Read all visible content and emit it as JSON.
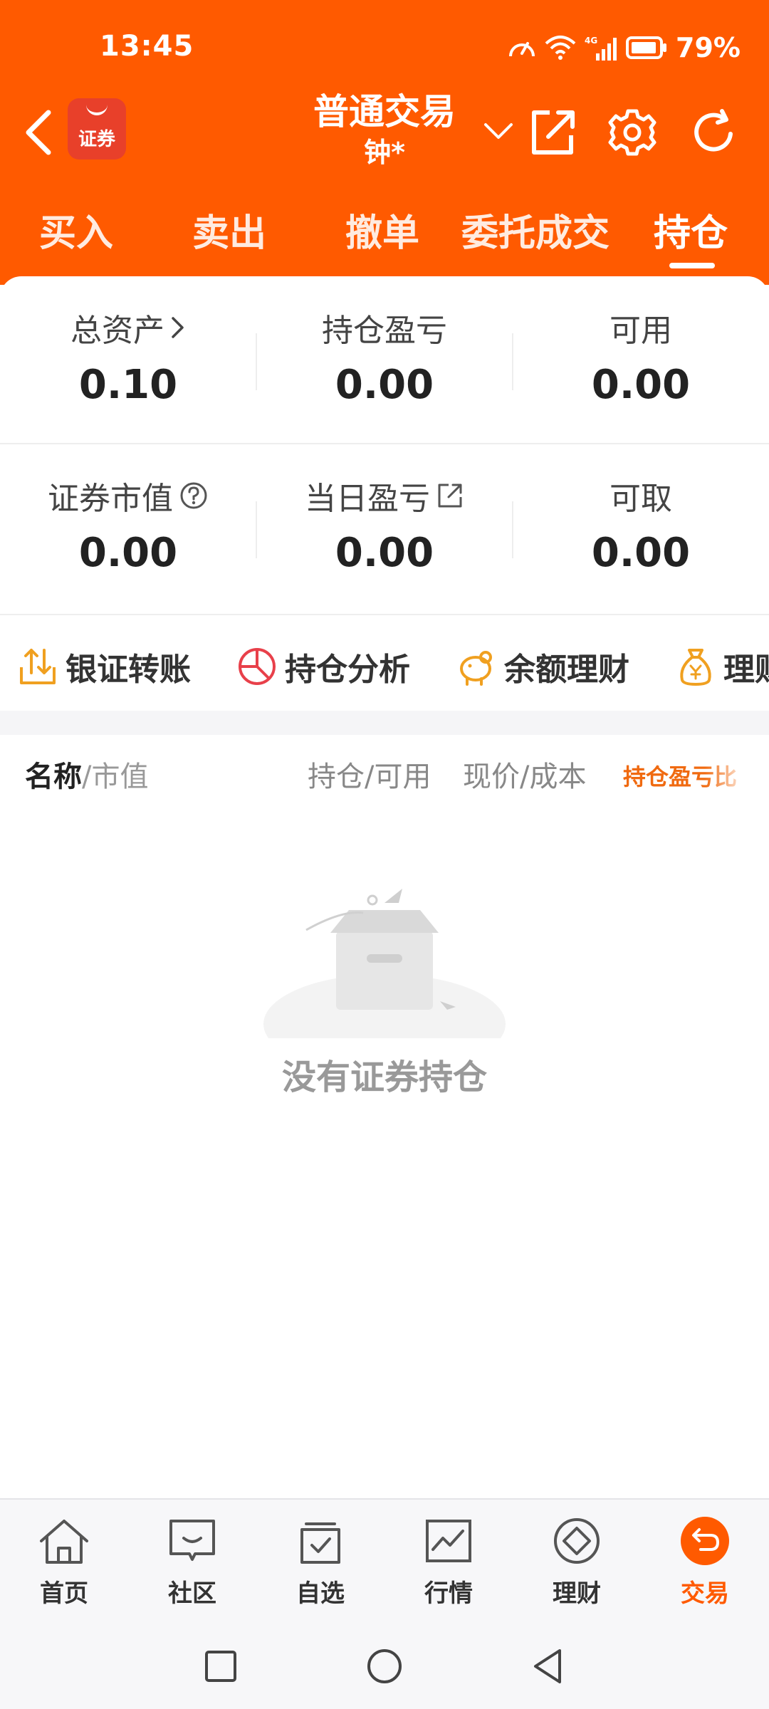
{
  "status_bar": {
    "time": "13:45",
    "battery": "79%",
    "network": "4G"
  },
  "header": {
    "title": "普通交易",
    "account": "钟*",
    "logo_text": "证券",
    "brand_color": "#ff5a00",
    "icons": [
      "back-icon",
      "share-icon",
      "gear-icon",
      "refresh-icon"
    ]
  },
  "tabs": [
    {
      "label": "买入",
      "active": false
    },
    {
      "label": "卖出",
      "active": false
    },
    {
      "label": "撤单",
      "active": false
    },
    {
      "label": "委托成交",
      "active": false
    },
    {
      "label": "持仓",
      "active": true
    }
  ],
  "summary": {
    "row1": [
      {
        "label": "总资产",
        "value": "0.10"
      },
      {
        "label": "持仓盈亏",
        "value": "0.00"
      },
      {
        "label": "可用",
        "value": "0.00"
      }
    ],
    "row2": [
      {
        "label": "证券市值",
        "value": "0.00"
      },
      {
        "label": "当日盈亏",
        "value": "0.00"
      },
      {
        "label": "可取",
        "value": "0.00"
      }
    ]
  },
  "quick_actions": [
    {
      "label": "银证转账",
      "icon": "transfer-icon"
    },
    {
      "label": "持仓分析",
      "icon": "pie-chart-icon"
    },
    {
      "label": "余额理财",
      "icon": "piggy-bank-icon"
    },
    {
      "label": "理财",
      "icon": "money-bag-icon"
    }
  ],
  "list_header": {
    "name": "名称",
    "name_sub": "/市值",
    "holding": "持仓/可用",
    "price": "现价/成本",
    "profit_ratio": "持仓盈亏比"
  },
  "empty_state": {
    "text": "没有证券持仓",
    "icon": "empty-box-icon"
  },
  "bottom_nav": [
    {
      "label": "首页",
      "icon": "home-icon",
      "active": false
    },
    {
      "label": "社区",
      "icon": "community-icon",
      "active": false
    },
    {
      "label": "自选",
      "icon": "watchlist-icon",
      "active": false
    },
    {
      "label": "行情",
      "icon": "market-chart-icon",
      "active": false
    },
    {
      "label": "理财",
      "icon": "wealth-icon",
      "active": false
    },
    {
      "label": "交易",
      "icon": "trade-icon",
      "active": true
    }
  ],
  "colors": {
    "accent": "#ff5a00",
    "sort_accent": "#f06a10",
    "muted": "#999999"
  }
}
